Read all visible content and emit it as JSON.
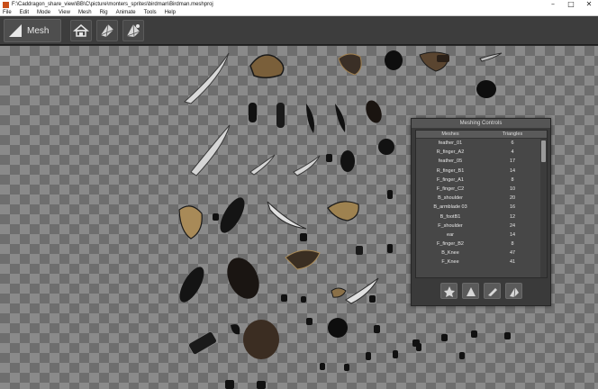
{
  "window": {
    "title": "F:\\Caddragon_share_view\\BB\\C\\picture\\monters_sprites\\birdman\\Birdman.meshproj",
    "minimize": "–",
    "maximize": "□",
    "close": "✕"
  },
  "menu": {
    "items": [
      "File",
      "Edit",
      "Mode",
      "View",
      "Mesh",
      "Rig",
      "Animate",
      "Tools",
      "Help"
    ]
  },
  "toolbar": {
    "mode_label": "Mesh",
    "mode_icon": "mesh-mode-icon",
    "tools": [
      "house-icon",
      "mesh-tool-icon",
      "mesh-edit-icon"
    ]
  },
  "panel": {
    "title": "Meshing Controls",
    "columns": [
      "Meshes",
      "Triangles"
    ],
    "rows": [
      {
        "name": "feather_01",
        "tris": "6"
      },
      {
        "name": "R_finger_A2",
        "tris": "4"
      },
      {
        "name": "feather_05",
        "tris": "17"
      },
      {
        "name": "R_finger_B1",
        "tris": "14"
      },
      {
        "name": "F_finger_A1",
        "tris": "8"
      },
      {
        "name": "F_finger_C2",
        "tris": "10"
      },
      {
        "name": "B_shoulder",
        "tris": "20"
      },
      {
        "name": "B_armblade 03",
        "tris": "16"
      },
      {
        "name": "B_footB1",
        "tris": "12"
      },
      {
        "name": "F_shoulder",
        "tris": "24"
      },
      {
        "name": "ear",
        "tris": "14"
      },
      {
        "name": "F_finger_B2",
        "tris": "8"
      },
      {
        "name": "B_Knee",
        "tris": "47"
      },
      {
        "name": "F_Knee",
        "tris": "41"
      }
    ],
    "buttons": [
      "star-icon",
      "triangle-icon",
      "knife-icon",
      "mesh-regen-icon"
    ]
  }
}
